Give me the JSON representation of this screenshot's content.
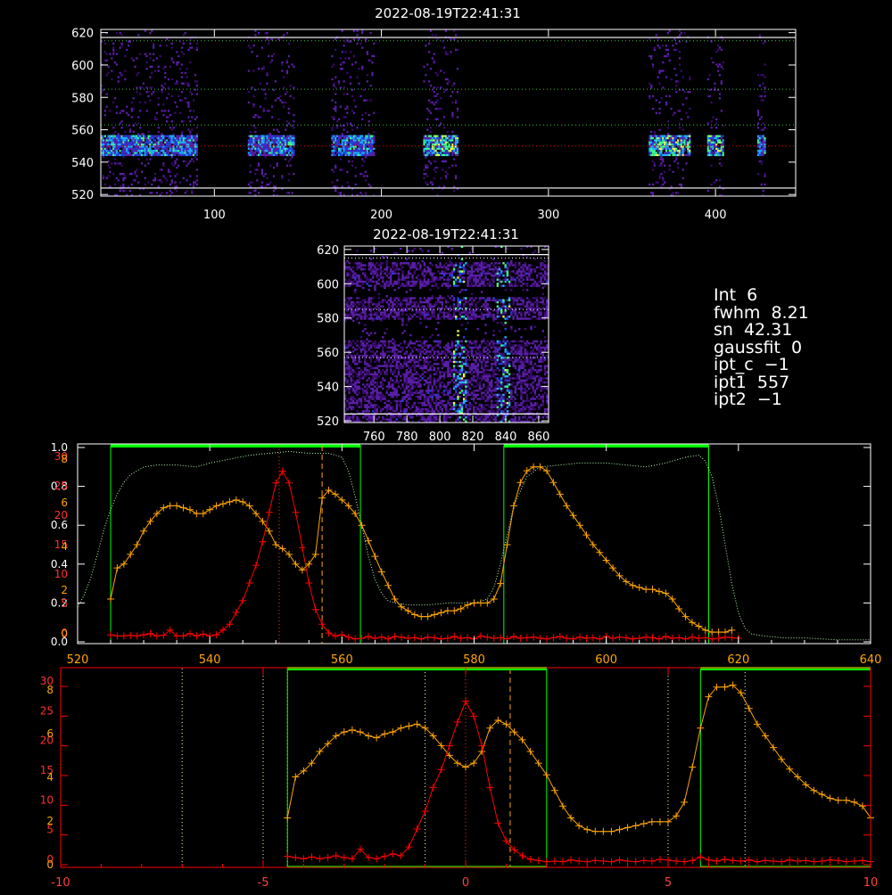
{
  "colors": {
    "background": "#000000",
    "axes": "#ffffff",
    "orange": "#ffa500",
    "red": "#ff0000",
    "green_box": "#00ff00",
    "dotted_green": "#b8ffb0",
    "image_colormap": [
      "#000000",
      "#3a0a6e",
      "#5a1fa8",
      "#2040e0",
      "#20b0ff",
      "#40ff90",
      "#f0ff40"
    ]
  },
  "panels": {
    "top": {
      "title": "2022-08-19T22:41:31"
    },
    "middle": {
      "title": "2022-08-19T22:41:31"
    }
  },
  "readout": [
    {
      "label": "Int",
      "value": "6"
    },
    {
      "label": "fwhm",
      "value": "8.21"
    },
    {
      "label": "sn",
      "value": "42.31"
    },
    {
      "label": "gaussfit",
      "value": "0"
    },
    {
      "label": "ipt_c",
      "value": "−1"
    },
    {
      "label": "ipt1",
      "value": "557"
    },
    {
      "label": "ipt2",
      "value": "−1"
    }
  ],
  "chart_data": [
    {
      "type": "heatmap",
      "title": "2022-08-19T22:41:31",
      "xlim": [
        32,
        448
      ],
      "ylim": [
        519,
        622
      ],
      "xticks": [
        100,
        200,
        300,
        400
      ],
      "yticks": [
        520,
        540,
        560,
        580,
        600,
        620
      ],
      "solid_hlines": [
        524,
        617
      ],
      "dotted_green_hlines": [
        563,
        585,
        615
      ],
      "dotted_red_hline": 550,
      "columns_with_signal": [
        [
          32,
          90
        ],
        [
          120,
          148
        ],
        [
          170,
          196
        ],
        [
          225,
          246
        ],
        [
          360,
          385
        ],
        [
          395,
          405
        ],
        [
          425,
          430
        ]
      ],
      "bright_band": [
        543,
        556
      ]
    },
    {
      "type": "heatmap",
      "title": "2022-08-19T22:41:31",
      "xlim": [
        742,
        866
      ],
      "ylim": [
        519,
        622
      ],
      "xticks": [
        760,
        780,
        800,
        820,
        840,
        860
      ],
      "yticks": [
        520,
        540,
        560,
        580,
        600,
        620
      ],
      "solid_hlines": [
        524,
        617
      ],
      "dotted_hlines": [
        557,
        585,
        615
      ],
      "bright_streaks_x": [
        812,
        838
      ]
    },
    {
      "type": "line",
      "xlim": [
        520,
        640
      ],
      "xticks": [
        520,
        540,
        560,
        580,
        600,
        620,
        640
      ],
      "left_ticks_white": [
        "0.0",
        "0.2",
        "0.4",
        "0.6",
        "0.8",
        "1.0"
      ],
      "left_ticks_red": [
        "0",
        "5",
        "10",
        "15",
        "20",
        "25",
        "30"
      ],
      "left_ticks_orange": [
        "0",
        "2",
        "4",
        "6",
        "8"
      ],
      "green_boxes": [
        [
          525,
          562.8
        ],
        [
          584.5,
          615.5
        ]
      ],
      "dotted_vline": 550.5,
      "dashed_vline": 557,
      "series": [
        {
          "color": "orange",
          "x": [
            525,
            526,
            527,
            528,
            529,
            530,
            531,
            532,
            533,
            534,
            535,
            536,
            537,
            538,
            539,
            540,
            541,
            542,
            543,
            544,
            545,
            546,
            547,
            548,
            549,
            550,
            551,
            552,
            553,
            554,
            555,
            556,
            557,
            558,
            559,
            560,
            561,
            562,
            563,
            564,
            565,
            566,
            567,
            568,
            569,
            570,
            571,
            572,
            573,
            574,
            575,
            576,
            577,
            578,
            579,
            580,
            581,
            582,
            583,
            584,
            585,
            586,
            587,
            588,
            589,
            590,
            591,
            592,
            593,
            594,
            595,
            596,
            597,
            598,
            599,
            600,
            601,
            602,
            603,
            604,
            605,
            606,
            607,
            608,
            609,
            610,
            611,
            612,
            613,
            614,
            615,
            616,
            617,
            618,
            619
          ],
          "y": [
            0.22,
            0.38,
            0.4,
            0.45,
            0.5,
            0.57,
            0.62,
            0.66,
            0.69,
            0.7,
            0.7,
            0.69,
            0.68,
            0.66,
            0.66,
            0.68,
            0.7,
            0.71,
            0.72,
            0.73,
            0.72,
            0.7,
            0.66,
            0.62,
            0.57,
            0.5,
            0.48,
            0.45,
            0.4,
            0.37,
            0.4,
            0.45,
            0.74,
            0.78,
            0.76,
            0.73,
            0.7,
            0.66,
            0.6,
            0.52,
            0.44,
            0.36,
            0.29,
            0.22,
            0.18,
            0.16,
            0.14,
            0.13,
            0.13,
            0.14,
            0.15,
            0.16,
            0.16,
            0.17,
            0.19,
            0.2,
            0.2,
            0.2,
            0.22,
            0.3,
            0.5,
            0.7,
            0.82,
            0.88,
            0.9,
            0.9,
            0.88,
            0.82,
            0.76,
            0.7,
            0.65,
            0.6,
            0.55,
            0.5,
            0.46,
            0.42,
            0.38,
            0.34,
            0.31,
            0.29,
            0.28,
            0.27,
            0.27,
            0.26,
            0.25,
            0.22,
            0.17,
            0.13,
            0.1,
            0.08,
            0.06,
            0.05,
            0.05,
            0.05,
            0.06
          ]
        },
        {
          "color": "red",
          "x": [
            525,
            526,
            527,
            528,
            529,
            530,
            531,
            532,
            533,
            534,
            535,
            536,
            537,
            538,
            539,
            540,
            541,
            542,
            543,
            544,
            545,
            546,
            547,
            548,
            549,
            550,
            551,
            552,
            553,
            554,
            555,
            556,
            557,
            558,
            559,
            560,
            561,
            562,
            563,
            564,
            565,
            566,
            567,
            568,
            569,
            570,
            571,
            572,
            573,
            574,
            575,
            576,
            577,
            578,
            579,
            580,
            581,
            582,
            583,
            584,
            585,
            586,
            587,
            588,
            589,
            590,
            591,
            592,
            593,
            594,
            595,
            596,
            597,
            598,
            599,
            600,
            601,
            602,
            603,
            604,
            605,
            606,
            607,
            608,
            609,
            610,
            611,
            612,
            613,
            614,
            615,
            616,
            617,
            618,
            619,
            620
          ],
          "y": [
            1.2,
            1.0,
            1.0,
            1.1,
            1.0,
            1.2,
            1.4,
            1.0,
            1.1,
            2.0,
            1.0,
            1.0,
            1.4,
            1.0,
            1.3,
            1.0,
            1.2,
            2.0,
            3.0,
            5.0,
            7.0,
            10.0,
            13.0,
            17.0,
            22.0,
            27.0,
            29.0,
            27.0,
            22.0,
            16.0,
            10.0,
            5.5,
            3.0,
            1.5,
            1.0,
            1.2,
            0.8,
            0.5,
            0.6,
            0.9,
            0.6,
            0.8,
            0.5,
            0.9,
            0.8,
            0.6,
            0.7,
            0.5,
            0.8,
            0.7,
            0.5,
            0.6,
            0.9,
            0.6,
            0.7,
            0.5,
            1.0,
            0.8,
            0.6,
            0.7,
            0.5,
            0.9,
            0.6,
            0.7,
            0.8,
            0.6,
            0.5,
            0.7,
            0.9,
            0.6,
            0.5,
            0.8,
            0.6,
            0.7,
            0.5,
            0.9,
            0.6,
            0.8,
            0.7,
            0.5,
            0.6,
            0.8,
            0.7,
            0.5,
            0.9,
            0.6,
            0.7,
            0.5,
            0.8,
            0.6,
            0.7,
            0.5,
            0.6,
            0.8,
            0.7,
            0.6
          ]
        },
        {
          "color": "dotted_green",
          "x": [
            520,
            521,
            522,
            523,
            524,
            525,
            526,
            527,
            528,
            530,
            532,
            535,
            538,
            540,
            543,
            546,
            549,
            552,
            555,
            558,
            560,
            561,
            562,
            563,
            564,
            565,
            566,
            567,
            568,
            570,
            573,
            576,
            580,
            582,
            583,
            584,
            585,
            586,
            588,
            590,
            593,
            596,
            600,
            603,
            606,
            609,
            612,
            614,
            615,
            616,
            617,
            618,
            619,
            620,
            621,
            622,
            624,
            627,
            630,
            635,
            640
          ],
          "y": [
            0.18,
            0.24,
            0.33,
            0.45,
            0.58,
            0.68,
            0.76,
            0.82,
            0.86,
            0.9,
            0.91,
            0.91,
            0.9,
            0.92,
            0.94,
            0.96,
            0.97,
            0.98,
            0.97,
            0.97,
            0.95,
            0.88,
            0.75,
            0.6,
            0.44,
            0.32,
            0.25,
            0.21,
            0.2,
            0.19,
            0.19,
            0.2,
            0.2,
            0.22,
            0.28,
            0.4,
            0.55,
            0.7,
            0.85,
            0.9,
            0.91,
            0.92,
            0.92,
            0.91,
            0.9,
            0.92,
            0.95,
            0.96,
            0.93,
            0.85,
            0.7,
            0.5,
            0.3,
            0.15,
            0.07,
            0.04,
            0.03,
            0.02,
            0.02,
            0.01,
            0.01
          ]
        }
      ]
    },
    {
      "type": "line",
      "xlim": [
        -10,
        10
      ],
      "xticks": [
        -10,
        -5,
        0,
        5,
        10
      ],
      "left_ticks_red": [
        "0",
        "5",
        "10",
        "15",
        "20",
        "25",
        "30"
      ],
      "left_ticks_orange": [
        "0",
        "2",
        "4",
        "6",
        "8"
      ],
      "green_boxes": [
        [
          -4.4,
          2.0
        ],
        [
          5.8,
          10.0
        ]
      ],
      "dotted_vlines": [
        -7.0,
        -5.0,
        -4.4,
        -1.0,
        0.0,
        5.0,
        6.9
      ],
      "dashed_vline": 1.1,
      "series": [
        {
          "color": "orange",
          "x": [
            -4.4,
            -4.2,
            -4.0,
            -3.8,
            -3.6,
            -3.4,
            -3.2,
            -3.0,
            -2.8,
            -2.6,
            -2.4,
            -2.2,
            -2.0,
            -1.8,
            -1.6,
            -1.4,
            -1.2,
            -1.0,
            -0.8,
            -0.6,
            -0.4,
            -0.2,
            0.0,
            0.2,
            0.4,
            0.6,
            0.8,
            1.0,
            1.2,
            1.4,
            1.6,
            1.8,
            2.0,
            2.2,
            2.4,
            2.6,
            2.8,
            3.0,
            3.2,
            3.4,
            3.6,
            3.8,
            4.0,
            4.2,
            4.4,
            4.6,
            4.8,
            5.0,
            5.2,
            5.4,
            5.6,
            5.8,
            6.0,
            6.2,
            6.4,
            6.6,
            6.8,
            7.0,
            7.2,
            7.4,
            7.6,
            7.8,
            8.0,
            8.2,
            8.4,
            8.6,
            8.8,
            9.0,
            9.2,
            9.4,
            9.6,
            9.8,
            10.0
          ],
          "y": [
            0.24,
            0.45,
            0.48,
            0.52,
            0.58,
            0.62,
            0.66,
            0.68,
            0.69,
            0.68,
            0.66,
            0.65,
            0.67,
            0.68,
            0.7,
            0.71,
            0.72,
            0.7,
            0.66,
            0.61,
            0.56,
            0.52,
            0.5,
            0.52,
            0.58,
            0.7,
            0.74,
            0.72,
            0.68,
            0.64,
            0.58,
            0.52,
            0.46,
            0.38,
            0.3,
            0.24,
            0.2,
            0.18,
            0.17,
            0.17,
            0.17,
            0.18,
            0.19,
            0.2,
            0.21,
            0.22,
            0.22,
            0.22,
            0.25,
            0.32,
            0.5,
            0.7,
            0.86,
            0.91,
            0.91,
            0.92,
            0.88,
            0.8,
            0.72,
            0.66,
            0.6,
            0.54,
            0.49,
            0.45,
            0.41,
            0.38,
            0.36,
            0.34,
            0.33,
            0.33,
            0.32,
            0.3,
            0.24
          ]
        },
        {
          "color": "red",
          "x": [
            -4.4,
            -4.2,
            -4.0,
            -3.8,
            -3.6,
            -3.4,
            -3.2,
            -3.0,
            -2.8,
            -2.6,
            -2.4,
            -2.2,
            -2.0,
            -1.8,
            -1.6,
            -1.4,
            -1.2,
            -1.0,
            -0.8,
            -0.6,
            -0.4,
            -0.2,
            0.0,
            0.2,
            0.4,
            0.6,
            0.8,
            1.0,
            1.2,
            1.4,
            1.6,
            1.8,
            2.0,
            2.2,
            2.4,
            2.6,
            2.8,
            3.0,
            3.2,
            3.4,
            3.6,
            3.8,
            4.0,
            4.2,
            4.4,
            4.6,
            4.8,
            5.0,
            5.2,
            5.4,
            5.6,
            5.8,
            6.0,
            6.2,
            6.4,
            6.6,
            6.8,
            7.0,
            7.2,
            7.4,
            7.6,
            7.8,
            8.0,
            8.2,
            8.4,
            8.6,
            8.8,
            9.0,
            9.2,
            9.4,
            9.6,
            9.8,
            10.0
          ],
          "y": [
            1.4,
            1.2,
            1.0,
            1.3,
            1.0,
            1.2,
            1.5,
            1.2,
            1.0,
            2.6,
            1.2,
            1.0,
            1.4,
            1.8,
            1.5,
            3.0,
            6.0,
            9.0,
            13.0,
            16.0,
            20.0,
            24.0,
            27.5,
            25.0,
            20.0,
            13.0,
            7.0,
            4.0,
            2.5,
            1.5,
            0.9,
            0.7,
            0.5,
            0.6,
            0.5,
            0.8,
            0.6,
            0.5,
            0.7,
            0.6,
            0.5,
            0.8,
            0.6,
            0.5,
            0.7,
            0.6,
            0.9,
            0.8,
            0.6,
            0.5,
            0.7,
            1.3,
            0.8,
            0.6,
            0.9,
            0.7,
            0.6,
            0.8,
            0.5,
            0.7,
            0.6,
            0.5,
            0.8,
            0.6,
            0.7,
            0.5,
            0.6,
            0.8,
            0.7,
            0.5,
            0.6,
            0.7,
            0.5
          ]
        }
      ]
    }
  ]
}
